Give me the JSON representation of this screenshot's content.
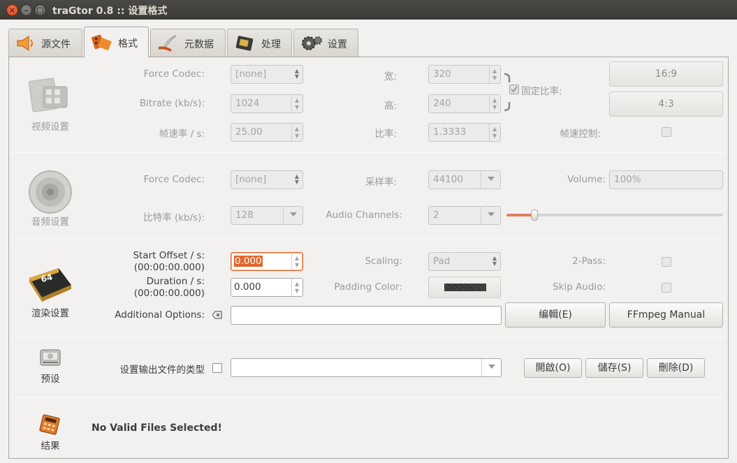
{
  "window": {
    "title": "traGtor 0.8 :: 设置格式"
  },
  "tabs": [
    {
      "label": "源文件",
      "icon": "speaker-source-icon"
    },
    {
      "label": "格式",
      "icon": "film-format-icon"
    },
    {
      "label": "元数据",
      "icon": "quill-metadata-icon"
    },
    {
      "label": "处理",
      "icon": "chip-process-icon"
    },
    {
      "label": "设置",
      "icon": "gears-settings-icon"
    }
  ],
  "video": {
    "section_label": "视频设置",
    "force_codec_label": "Force Codec:",
    "force_codec_value": "[none]",
    "bitrate_label": "Bitrate (kb/s):",
    "bitrate_value": "1024",
    "framerate_label": "帧速率 / s:",
    "framerate_value": "25.00",
    "width_label": "宽:",
    "width_value": "320",
    "height_label": "高:",
    "height_value": "240",
    "ratio_label": "比率:",
    "ratio_value": "1.3333",
    "fixed_ratio_label": "固定比率:",
    "ratio_16_9": "16:9",
    "ratio_4_3": "4:3",
    "framerate_control_label": "帧速控制:"
  },
  "audio": {
    "section_label": "音频设置",
    "force_codec_label": "Force Codec:",
    "force_codec_value": "[none]",
    "samplerate_label": "采样率:",
    "samplerate_value": "44100",
    "volume_label": "Volume:",
    "volume_value": "100%",
    "bitrate_label": "比特率 (kb/s):",
    "bitrate_value": "128",
    "channels_label": "Audio Channels:",
    "channels_value": "2",
    "volume_level": 0.13
  },
  "render": {
    "section_label": "渲染设置",
    "start_offset_label": "Start Offset / s:",
    "start_offset_time": "(00:00:00.000)",
    "start_offset_value": "0.000",
    "duration_label": "Duration / s:",
    "duration_time": "(00:00:00.000)",
    "duration_value": "0.000",
    "scaling_label": "Scaling:",
    "scaling_value": "Pad",
    "padding_color_label": "Padding Color:",
    "two_pass_label": "2-Pass:",
    "skip_audio_label": "Skip Audio:",
    "additional_options_label": "Additional Options:",
    "additional_options_value": "",
    "edit_button": "编輯(E)",
    "ffmpeg_manual_button": "FFmpeg Manual"
  },
  "preset": {
    "section_label": "预设",
    "output_type_label": "设置输出文件的类型",
    "output_type_value": "",
    "open_button": "開啟(O)",
    "save_button": "儲存(S)",
    "delete_button": "刪除(D)"
  },
  "result": {
    "section_label": "结果",
    "message": "No Valid Files Selected!"
  },
  "colors": {
    "accent": "#e0662a",
    "titlebar": "#3c3b37",
    "close": "#e9541f"
  }
}
